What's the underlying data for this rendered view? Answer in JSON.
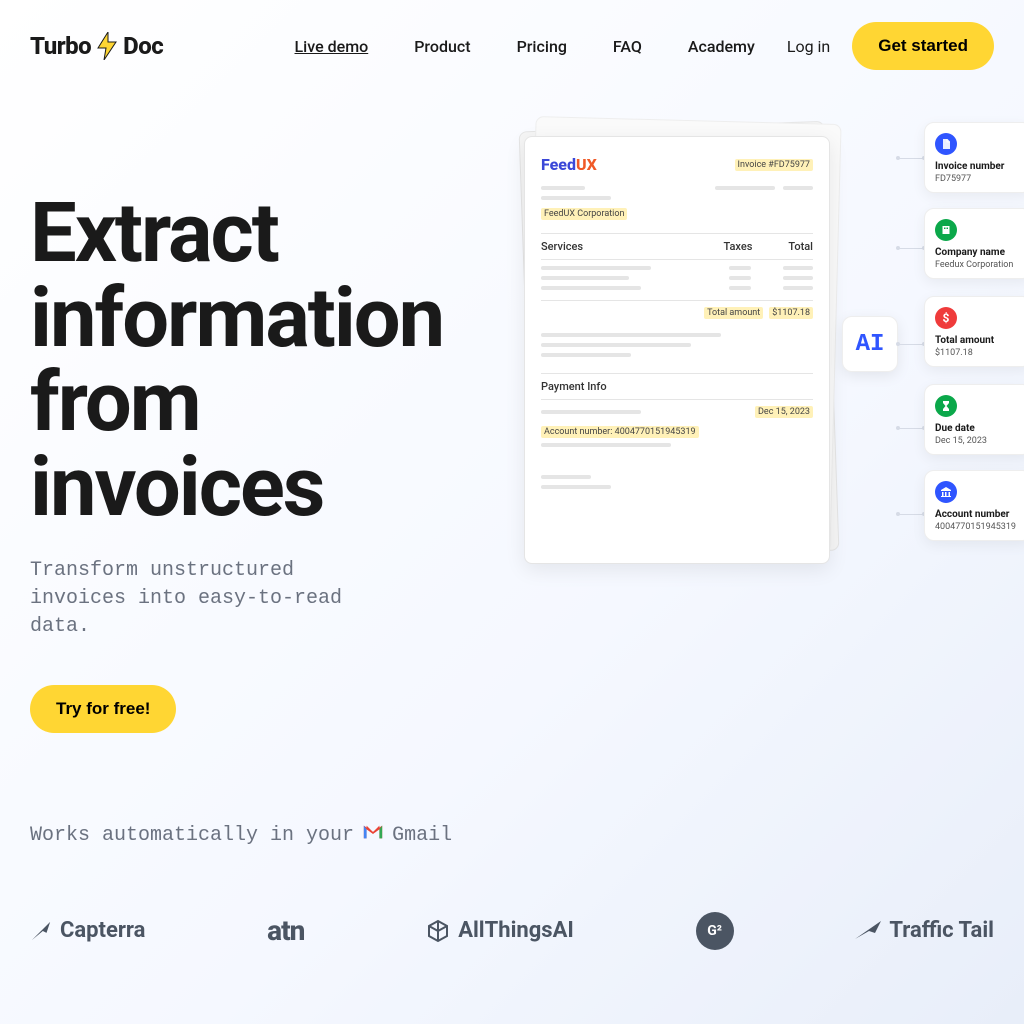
{
  "logo": {
    "part1": "Turbo",
    "part2": "Doc"
  },
  "nav": {
    "live_demo": "Live demo",
    "product": "Product",
    "pricing": "Pricing",
    "faq": "FAQ",
    "academy": "Academy"
  },
  "actions": {
    "login": "Log in",
    "get_started": "Get started"
  },
  "hero": {
    "title_l1": "Extract",
    "title_l2": "information",
    "title_l3": "from",
    "title_l4": "invoices",
    "subtitle": "Transform unstructured invoices into easy-to-read data.",
    "try": "Try for free!"
  },
  "doc": {
    "brand_a": "Feed",
    "brand_b": "UX",
    "invoice_badge": "Invoice #FD75977",
    "company_badge": "FeedUX Corporation",
    "h_services": "Services",
    "h_taxes": "Taxes",
    "h_total": "Total",
    "total_lbl": "Total amount",
    "total_val": "$1107.18",
    "pay_lbl": "Payment Info",
    "acct_badge": "Account number: 4004770151945319",
    "date_badge": "Dec 15, 2023"
  },
  "ai_label": "AI",
  "cards": [
    {
      "label": "Invoice number",
      "value": "FD75977"
    },
    {
      "label": "Company name",
      "value": "Feedux Corporation"
    },
    {
      "label": "Total amount",
      "value": "$1107.18"
    },
    {
      "label": "Due date",
      "value": "Dec 15, 2023"
    },
    {
      "label": "Account number",
      "value": "4004770151945319"
    }
  ],
  "gmail": {
    "prefix": "Works automatically in your",
    "name": "Gmail"
  },
  "partners": {
    "capterra": "Capterra",
    "atn": "atn",
    "allthings": "AllThingsAI",
    "traffic": "Traffic Tail"
  }
}
